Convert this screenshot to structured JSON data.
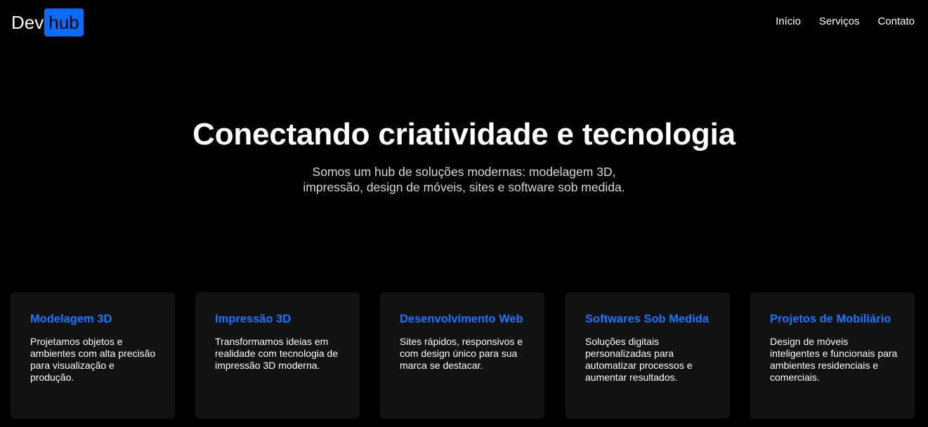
{
  "brand": {
    "logo_part1": "Dev",
    "logo_part2": "hub",
    "accent_color": "#0b6cf7"
  },
  "nav": {
    "items": [
      {
        "label": "Início"
      },
      {
        "label": "Serviços"
      },
      {
        "label": "Contato"
      }
    ]
  },
  "hero": {
    "title": "Conectando criatividade e tecnologia",
    "subtitle": "Somos um hub de soluções modernas: modelagem 3D, impressão, design de móveis, sites e software sob medida."
  },
  "services": [
    {
      "title": "Modelagem 3D",
      "description": "Projetamos objetos e ambientes com alta precisão para visualização e produção."
    },
    {
      "title": "Impressão 3D",
      "description": "Transformamos ideias em realidade com tecnologia de impressão 3D moderna."
    },
    {
      "title": "Desenvolvimento Web",
      "description": "Sites rápidos, responsivos e com design único para sua marca se destacar."
    },
    {
      "title": "Softwares Sob Medida",
      "description": "Soluções digitais personalizadas para automatizar processos e aumentar resultados."
    },
    {
      "title": "Projetos de Mobiliário",
      "description": "Design de móveis inteligentes e funcionais para ambientes residenciais e comerciais."
    }
  ]
}
